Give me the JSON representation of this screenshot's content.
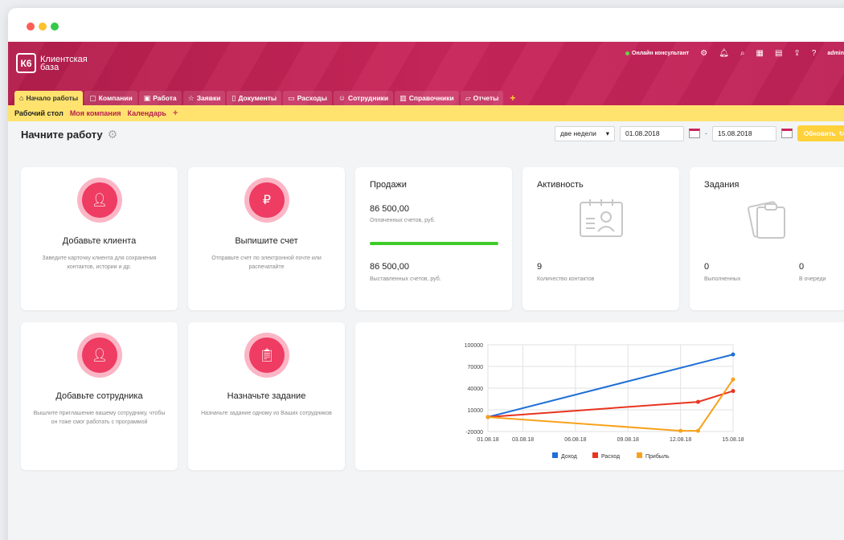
{
  "app": {
    "logo_short": "К6",
    "logo_text": "Клиентская база",
    "online_label": "Онлайн консультант",
    "user": "admin"
  },
  "tabs": [
    {
      "label": "Начало работы",
      "icon": "home-icon",
      "active": true
    },
    {
      "label": "Компании",
      "icon": "companies-icon"
    },
    {
      "label": "Работа",
      "icon": "briefcase-icon"
    },
    {
      "label": "Заявки",
      "icon": "star-icon"
    },
    {
      "label": "Документы",
      "icon": "document-icon"
    },
    {
      "label": "Расходы",
      "icon": "wallet-icon"
    },
    {
      "label": "Сотрудники",
      "icon": "users-icon"
    },
    {
      "label": "Справочники",
      "icon": "book-icon"
    },
    {
      "label": "Отчеты",
      "icon": "report-icon"
    }
  ],
  "tab_add": "+",
  "subnav": [
    {
      "label": "Рабочий стол",
      "active": true
    },
    {
      "label": "Моя компания"
    },
    {
      "label": "Календарь"
    }
  ],
  "subnav_add": "+",
  "page_title": "Начните работу",
  "controls": {
    "period": "две недели",
    "date_from": "01.08.2018",
    "date_to": "15.08.2018",
    "dash": "-",
    "update_button": "Обновить"
  },
  "cards": {
    "add_client": {
      "title": "Добавьте клиента",
      "desc": "Заведите карточку клиента для сохранения контактов, истории и др."
    },
    "issue_invoice": {
      "title": "Выпишите счет",
      "desc": "Отправьте счет по электронной почте или распечатайте"
    },
    "sales": {
      "title": "Продажи",
      "paid_value": "86 500,00",
      "paid_label": "Оплаченных счетов, руб.",
      "issued_value": "86 500,00",
      "issued_label": "Выставленных счетов, руб.",
      "progress": 1.0
    },
    "activity": {
      "title": "Активность",
      "value": "9",
      "label": "Количество контактов"
    },
    "tasks": {
      "title": "Задания",
      "done_value": "0",
      "done_label": "Выполненных",
      "queue_value": "0",
      "queue_label": "В очереди"
    },
    "add_employee": {
      "title": "Добавьте сотрудника",
      "desc": "Вышлите приглашение вашему сотруднику, чтобы он тоже смог работать с программой"
    },
    "assign_task": {
      "title": "Назначьте задание",
      "desc": "Назначьте задание одному из Ваших сотрудников"
    }
  },
  "colors": {
    "header": "#c8265a",
    "accent_yellow": "#ffe36e",
    "icon_pink": "#ee3c62",
    "income": "#1f6fd6",
    "expense": "#e8351f",
    "profit": "#f7a21b"
  },
  "chart_data": {
    "type": "line",
    "x": [
      "01.08.18",
      "03.08.18",
      "06.08.18",
      "09.08.18",
      "12.08.18",
      "15.08.18"
    ],
    "ylim": [
      -20000,
      100000
    ],
    "yticks": [
      "100000",
      "70000",
      "40000",
      "10000",
      "-20000"
    ],
    "grid": true,
    "legend": "bottom",
    "series": [
      {
        "name": "Доход",
        "color": "#1f6fd6",
        "points": [
          [
            "01.08.18",
            0
          ],
          [
            "15.08.18",
            86500
          ]
        ]
      },
      {
        "name": "Расход",
        "color": "#e8351f",
        "points": [
          [
            "01.08.18",
            0
          ],
          [
            "13.08.18",
            21000
          ],
          [
            "15.08.18",
            36000
          ]
        ]
      },
      {
        "name": "Прибыль",
        "color": "#f7a21b",
        "points": [
          [
            "01.08.18",
            0
          ],
          [
            "12.08.18",
            -19000
          ],
          [
            "13.08.18",
            -19000
          ],
          [
            "15.08.18",
            52000
          ]
        ]
      }
    ]
  }
}
